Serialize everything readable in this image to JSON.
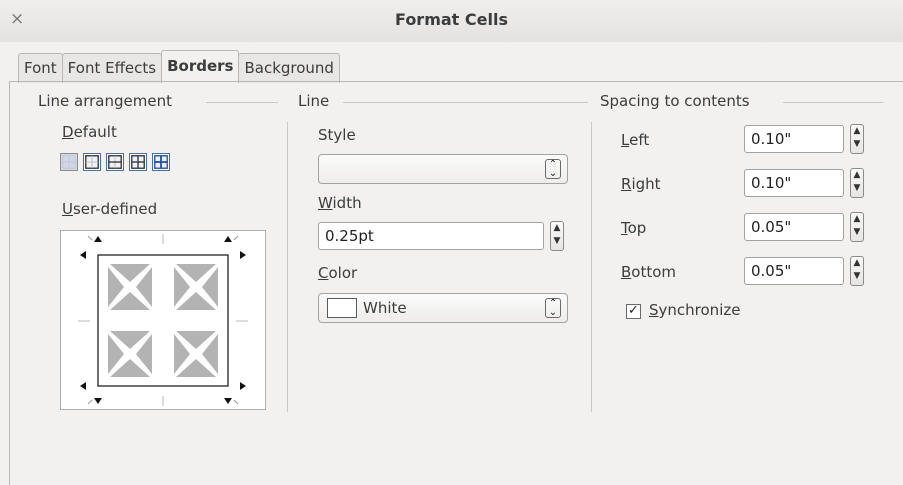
{
  "window": {
    "title": "Format Cells",
    "close_icon": "×"
  },
  "tabs": [
    {
      "label": "Font",
      "active": false
    },
    {
      "label": "Font Effects",
      "active": false
    },
    {
      "label": "Borders",
      "active": true
    },
    {
      "label": "Background",
      "active": false
    }
  ],
  "line_arrangement": {
    "title": "Line arrangement",
    "default_label": "Default",
    "user_defined_label": "User-defined"
  },
  "line": {
    "title": "Line",
    "style_label": "Style",
    "style_value": "",
    "width_label": "Width",
    "width_value": "0.25pt",
    "color_label": "Color",
    "color_value": "White",
    "color_hex": "#ffffff"
  },
  "spacing": {
    "title": "Spacing to contents",
    "left_label": "Left",
    "left_value": "0.10\"",
    "right_label": "Right",
    "right_value": "0.10\"",
    "top_label": "Top",
    "top_value": "0.05\"",
    "bottom_label": "Bottom",
    "bottom_value": "0.05\"",
    "synchronize_label": "Synchronize",
    "synchronize_checked": true
  }
}
